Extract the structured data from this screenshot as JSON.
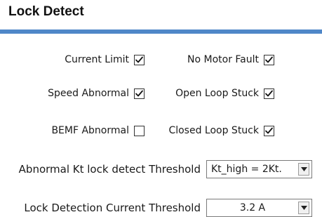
{
  "section": {
    "title": "Lock Detect"
  },
  "accent_color": "#4f87c8",
  "checkboxes": [
    {
      "label": "Current Limit",
      "checked": true
    },
    {
      "label": "No Motor Fault",
      "checked": true
    },
    {
      "label": "Speed Abnormal",
      "checked": true
    },
    {
      "label": "Open Loop Stuck",
      "checked": true
    },
    {
      "label": "BEMF Abnormal",
      "checked": false
    },
    {
      "label": "Closed Loop Stuck",
      "checked": true
    }
  ],
  "kt_threshold": {
    "label": "Abnormal Kt lock detect Threshold",
    "value": "Kt_high = 2Kt."
  },
  "current_threshold": {
    "label": "Lock Detection Current Threshold",
    "value": "3.2 A"
  },
  "icons": {
    "checkmark": "checkmark-icon",
    "dropdown": "chevron-down-icon"
  }
}
